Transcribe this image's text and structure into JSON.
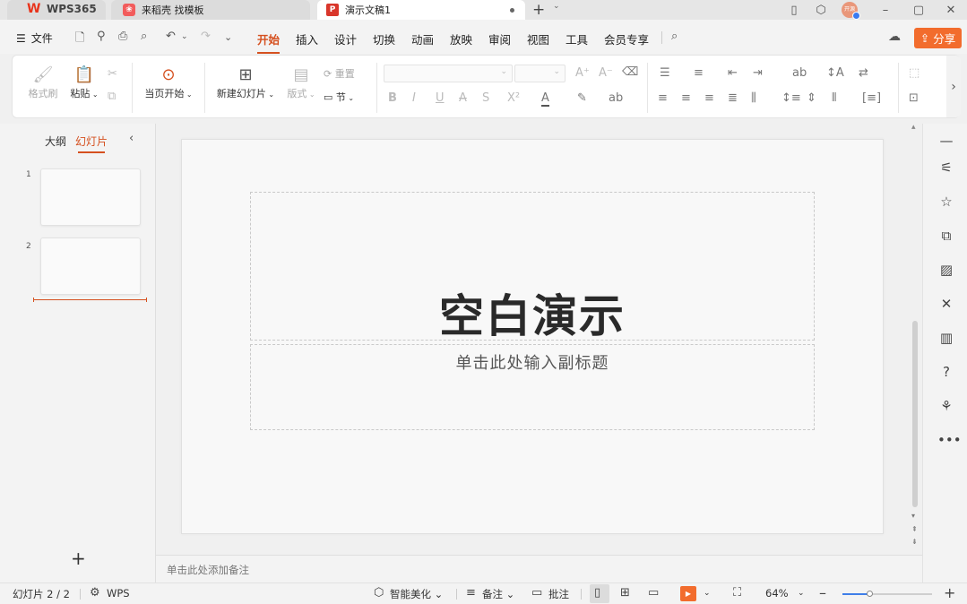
{
  "titlebar": {
    "tabs": [
      {
        "label": "WPS365",
        "logo": "W"
      },
      {
        "label": "来稻壳 找模板"
      },
      {
        "label": "演示文稿1"
      }
    ],
    "new_tab": "+",
    "icons": [
      "layout-icon",
      "box-icon",
      "minimize-icon",
      "maximize-icon",
      "close-icon"
    ],
    "avatar_text": "开源"
  },
  "menubar": {
    "file": "文件",
    "tabs": [
      "开始",
      "插入",
      "设计",
      "切换",
      "动画",
      "放映",
      "审阅",
      "视图",
      "工具",
      "会员专享"
    ],
    "active_tab": "开始",
    "share": "分享"
  },
  "ribbon": {
    "format_painter": "格式刷",
    "paste": "粘贴",
    "from_current": "当页开始",
    "new_slide": "新建幻灯片",
    "layout": "版式",
    "reset": "重置",
    "section": "节",
    "font_name": "",
    "font_size": "",
    "format_buttons": [
      "B",
      "I",
      "U",
      "A",
      "S",
      "X²"
    ]
  },
  "left_panel": {
    "tabs": [
      "大纲",
      "幻灯片"
    ],
    "active_tab": "幻灯片",
    "slides": [
      {
        "num": "1"
      },
      {
        "num": "2"
      }
    ]
  },
  "slide": {
    "title": "空白演示",
    "subtitle": "单击此处输入副标题"
  },
  "notes": {
    "placeholder": "单击此处添加备注"
  },
  "statusbar": {
    "slide_count": "幻灯片 2 / 2",
    "wps": "WPS",
    "smart_beautify": "智能美化",
    "notes": "备注",
    "comments": "批注",
    "zoom": "64%",
    "zoom_fraction": 0.3
  },
  "colors": {
    "accent": "#d5501f",
    "share": "#f26c2d",
    "zoom": "#3f7ee8"
  }
}
